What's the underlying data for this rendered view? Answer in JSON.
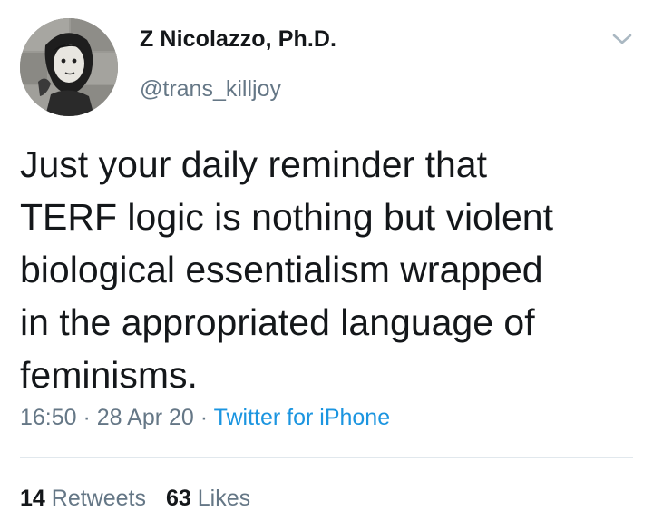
{
  "author": {
    "name": "Z Nicolazzo, Ph.D.",
    "handle": "@trans_killjoy",
    "avatar_icon": "profile-photo"
  },
  "tweet": {
    "text": "Just your daily reminder that\nTERF logic is nothing but violent\nbiological essentialism wrapped\nin the appropriated language of\nfeminisms.",
    "time": "16:50",
    "separator": " · ",
    "date": "28 Apr 20",
    "source": "Twitter for iPhone"
  },
  "stats": {
    "retweets_count": "14",
    "retweets_label": "Retweets",
    "likes_count": "63",
    "likes_label": "Likes"
  },
  "icons": {
    "menu": "chevron-down-icon"
  },
  "colors": {
    "text": "#14171a",
    "secondary": "#657786",
    "link": "#1b95e0",
    "divider": "#e1e8ed"
  }
}
